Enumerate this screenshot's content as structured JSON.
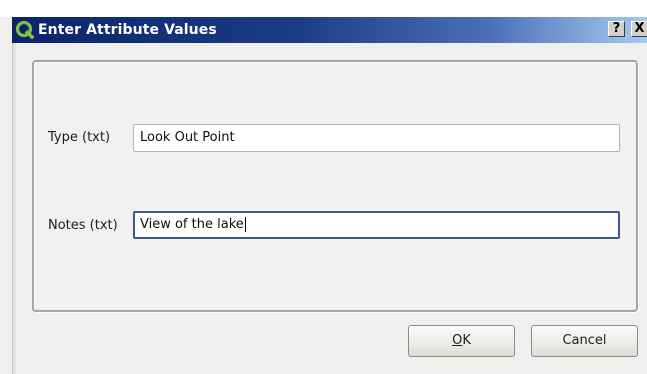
{
  "window": {
    "title": "Enter Attribute Values",
    "app_icon": "qgis-icon",
    "help_label": "?",
    "close_label": "X"
  },
  "form": {
    "fields": [
      {
        "label": "Type (txt)",
        "value": "Look Out Point"
      },
      {
        "label": "Notes (txt)",
        "value": "View of the lake"
      }
    ]
  },
  "buttons": {
    "ok_mnemonic": "O",
    "ok_rest": "K",
    "cancel_label": "Cancel"
  },
  "colors": {
    "titlebar_start": "#0a246a",
    "titlebar_end": "#a6caf0",
    "focus_border": "#3b5a8c"
  }
}
